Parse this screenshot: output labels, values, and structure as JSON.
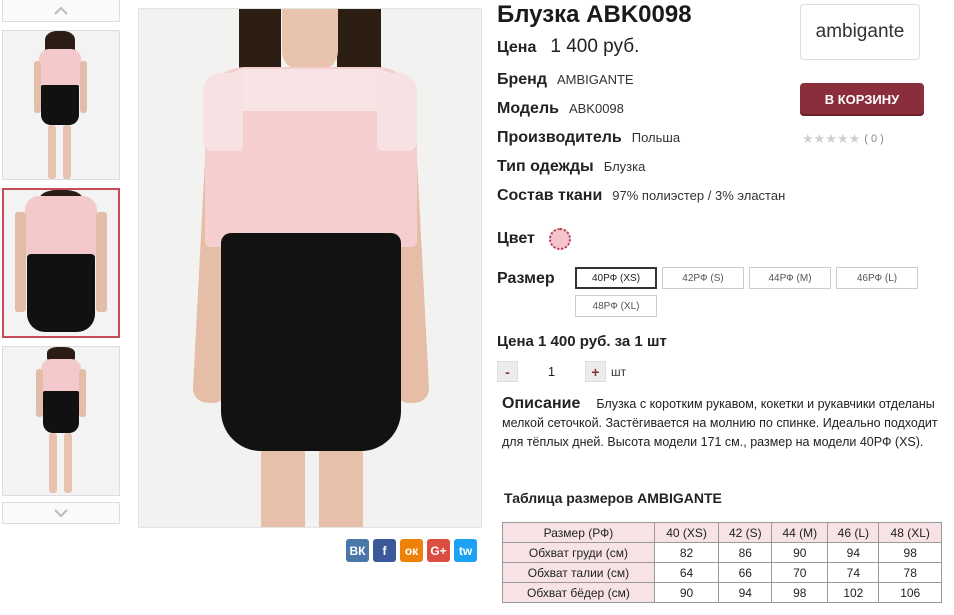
{
  "product": {
    "title": "Блузка ABK0098",
    "price_label": "Цена",
    "price": "1 400 руб.",
    "attributes": [
      {
        "label": "Бренд",
        "value": "AMBIGANTE"
      },
      {
        "label": "Модель",
        "value": "ABK0098"
      },
      {
        "label": "Производитель",
        "value": "Польша"
      },
      {
        "label": "Тип одежды",
        "value": "Блузка"
      },
      {
        "label": "Состав ткани",
        "value": "97% полиэстер / 3% эластан"
      }
    ],
    "color_label": "Цвет",
    "selected_color": "#f5c4cc",
    "size_label": "Размер",
    "sizes": [
      "40РФ (XS)",
      "42РФ (S)",
      "44РФ (M)",
      "46РФ (L)",
      "48РФ (XL)"
    ],
    "selected_size": "40РФ (XS)",
    "total": "Цена 1 400 руб. за 1 шт",
    "qty_minus": "-",
    "qty_plus": "+",
    "quantity": "1",
    "qty_unit": "шт",
    "description_label": "Описание",
    "description": "Блузка с коротким рукавом, кокетки и рукавчики отделаны мелкой сеточкой. Застёгивается на молнию по спинке. Идеально подходит для тёплых дней. Высота модели 171 см., размер на модели 40РФ (XS)."
  },
  "brand_logo_text": "ambigante",
  "cart_button": "В КОРЗИНУ",
  "rating": {
    "stars": "★★★★★",
    "count": "( 0 )"
  },
  "social": [
    "ВК",
    "f",
    "ок",
    "G+",
    "tw"
  ],
  "size_table": {
    "title": "Таблица размеров AMBIGANTE",
    "headers": [
      "Размер (РФ)",
      "40 (XS)",
      "42 (S)",
      "44 (M)",
      "46 (L)",
      "48 (XL)"
    ],
    "rows": [
      [
        "Обхват груди (см)",
        "82",
        "86",
        "90",
        "94",
        "98"
      ],
      [
        "Обхват талии (см)",
        "64",
        "66",
        "70",
        "74",
        "78"
      ],
      [
        "Обхват бёдер (см)",
        "90",
        "94",
        "98",
        "102",
        "106"
      ]
    ]
  },
  "colors": {
    "accent": "#8b2e3c",
    "table_header_bg": "#f7e3e5",
    "active_thumb_border": "#c94a5a"
  }
}
